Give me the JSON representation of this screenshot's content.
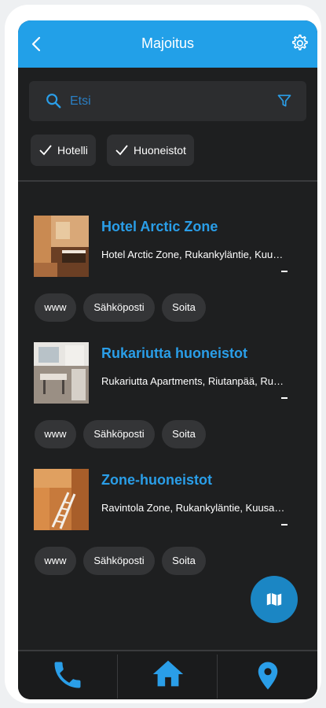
{
  "header": {
    "title": "Majoitus"
  },
  "search": {
    "placeholder": "Etsi",
    "value": ""
  },
  "filters": [
    {
      "label": "Hotelli",
      "checked": true
    },
    {
      "label": "Huoneistot",
      "checked": true
    }
  ],
  "listings": [
    {
      "name": "Hotel Arctic Zone",
      "address": "Hotel Arctic Zone, Rukankyläntie, Kuusamo",
      "image": "hotel-room-photo",
      "actions": [
        "www",
        "Sähköposti",
        "Soita"
      ]
    },
    {
      "name": "Rukariutta huoneistot",
      "address": "Rukariutta Apartments, Riutanpää, Rukatunturi",
      "image": "apartment-interior-photo",
      "actions": [
        "www",
        "Sähköposti",
        "Soita"
      ]
    },
    {
      "name": "Zone-huoneistot",
      "address": "Ravintola Zone, Rukankyläntie, Kuusamo",
      "image": "wooden-stairs-photo",
      "actions": [
        "www",
        "Sähköposti",
        "Soita"
      ]
    }
  ],
  "fab": {
    "icon": "map-icon"
  },
  "bottom_nav": [
    {
      "icon": "phone-icon"
    },
    {
      "icon": "home-icon"
    },
    {
      "icon": "location-pin-icon"
    }
  ],
  "colors": {
    "accent": "#22a0e8",
    "title_blue": "#2a9ee8",
    "background": "#1e1f20",
    "chip_bg": "#2f3032"
  }
}
